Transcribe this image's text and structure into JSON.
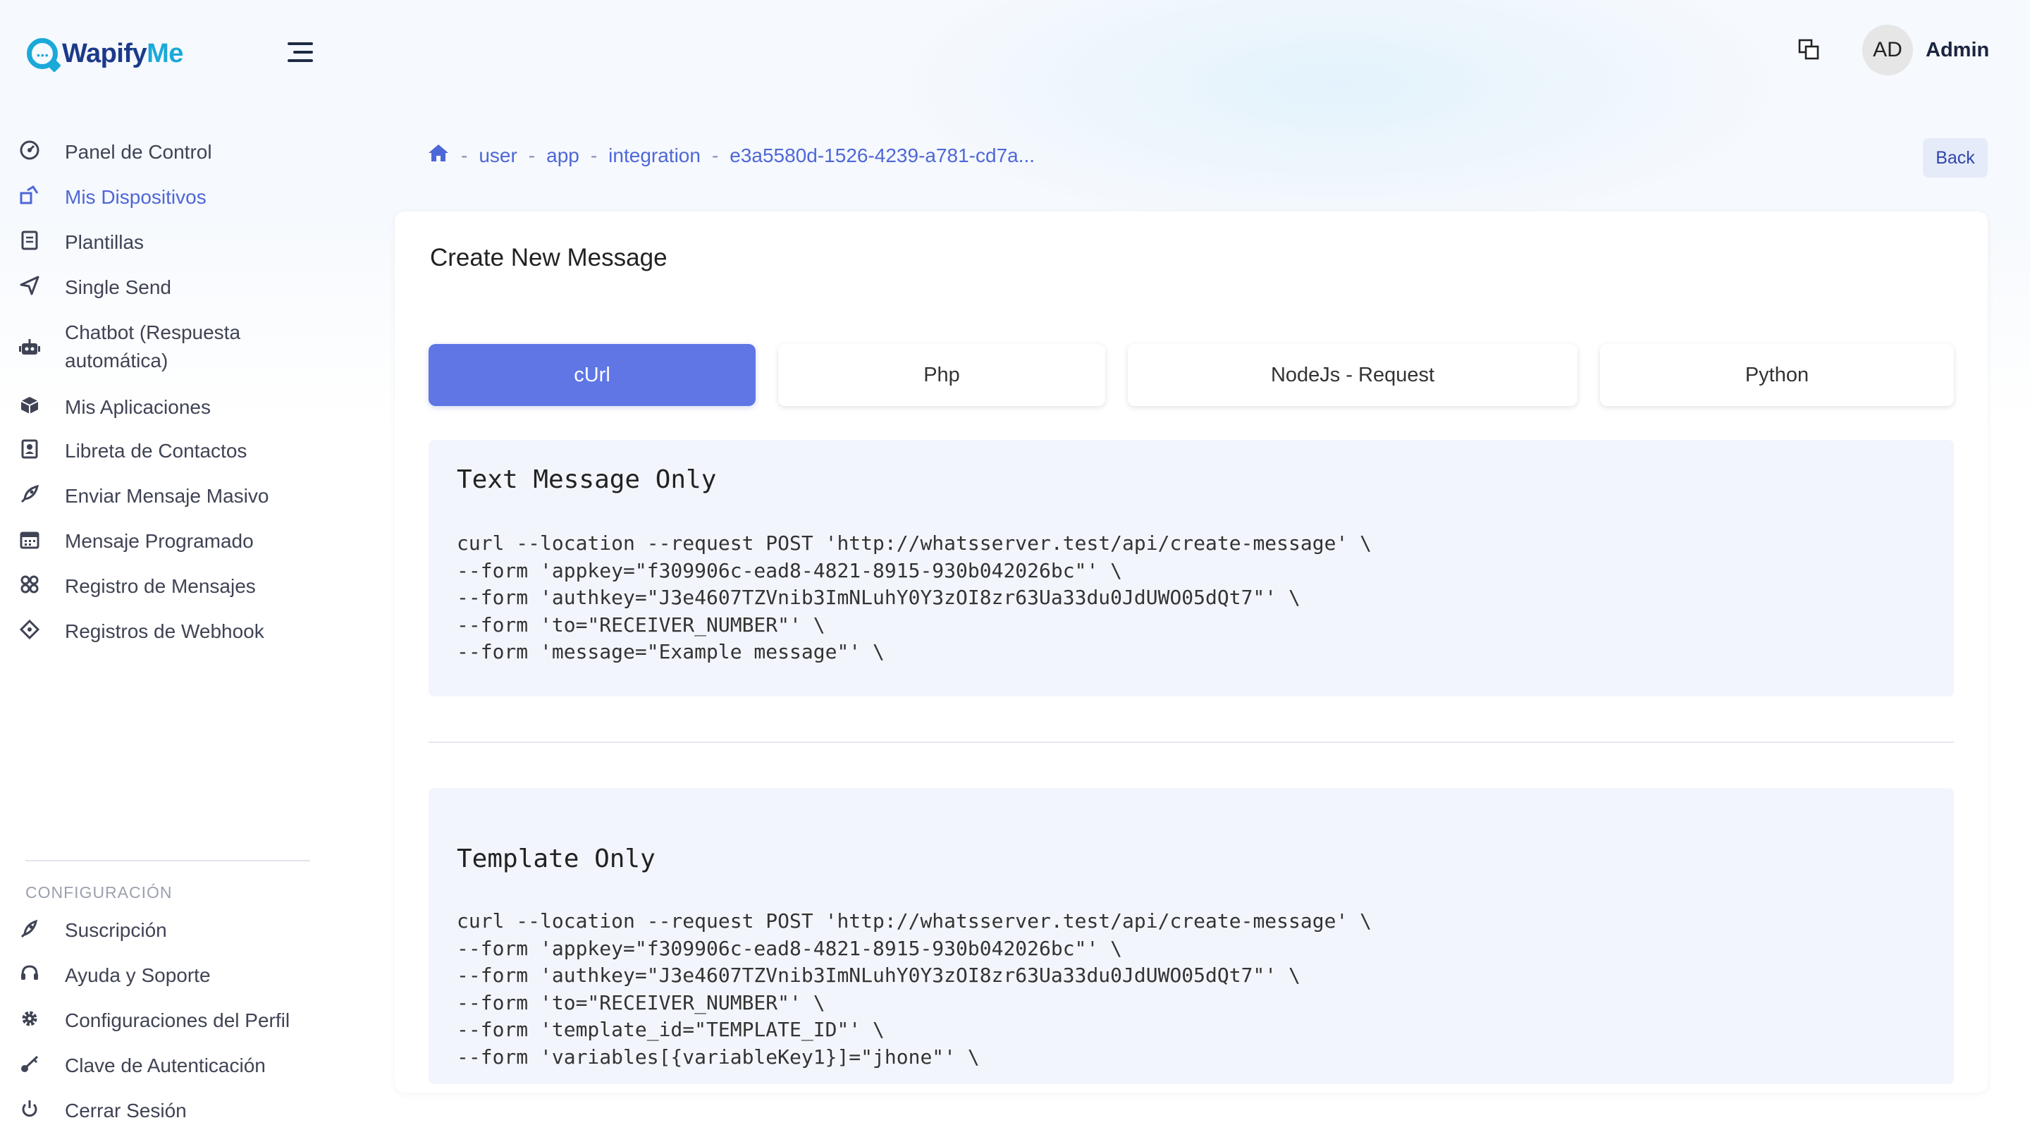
{
  "brand": {
    "name_part1": "Wapify",
    "name_part2": "Me"
  },
  "header": {
    "avatar_initials": "AD",
    "user_name": "Admin"
  },
  "sidebar": {
    "items": [
      {
        "label": "Panel de Control",
        "icon": "dashboard-icon"
      },
      {
        "label": "Mis Dispositivos",
        "icon": "devices-icon",
        "active": true
      },
      {
        "label": "Plantillas",
        "icon": "templates-icon"
      },
      {
        "label": "Single Send",
        "icon": "send-icon"
      },
      {
        "label": "Chatbot (Respuesta automática)",
        "icon": "robot-icon"
      },
      {
        "label": "Mis Aplicaciones",
        "icon": "box-icon"
      },
      {
        "label": "Libreta de Contactos",
        "icon": "contacts-icon"
      },
      {
        "label": "Enviar Mensaje Masivo",
        "icon": "rocket-icon"
      },
      {
        "label": "Mensaje Programado",
        "icon": "calendar-icon"
      },
      {
        "label": "Registro de Mensajes",
        "icon": "logs-icon"
      },
      {
        "label": "Registros de Webhook",
        "icon": "webhook-icon"
      }
    ],
    "settings_title": "CONFIGURACIÓN",
    "settings_items": [
      {
        "label": "Suscripción",
        "icon": "subscription-icon"
      },
      {
        "label": "Ayuda y Soporte",
        "icon": "headset-icon"
      },
      {
        "label": "Configuraciones del Perfil",
        "icon": "gear-icon"
      },
      {
        "label": "Clave de Autenticación",
        "icon": "key-icon"
      },
      {
        "label": "Cerrar Sesión",
        "icon": "power-icon"
      }
    ]
  },
  "breadcrumb": {
    "items": [
      "user",
      "app",
      "integration",
      "e3a5580d-1526-4239-a781-cd7a..."
    ],
    "separator": "-"
  },
  "back_label": "Back",
  "card": {
    "title": "Create New Message",
    "tabs": [
      "cUrl",
      "Php",
      "NodeJs - Request",
      "Python"
    ],
    "active_tab": "cUrl",
    "sections": [
      {
        "heading": "Text Message Only",
        "lines": [
          "curl --location --request POST 'http://whatsserver.test/api/create-message' \\",
          "--form 'appkey=\"f309906c-ead8-4821-8915-930b042026bc\"' \\",
          "--form 'authkey=\"J3e4607TZVnib3ImNLuhY0Y3zOI8zr63Ua33du0JdUWO05dQt7\"' \\",
          "--form 'to=\"RECEIVER_NUMBER\"' \\",
          "--form 'message=\"Example message\"' \\"
        ]
      },
      {
        "heading": "Template Only",
        "lines": [
          "curl --location --request POST 'http://whatsserver.test/api/create-message' \\",
          "--form 'appkey=\"f309906c-ead8-4821-8915-930b042026bc\"' \\",
          "--form 'authkey=\"J3e4607TZVnib3ImNLuhY0Y3zOI8zr63Ua33du0JdUWO05dQt7\"' \\",
          "--form 'to=\"RECEIVER_NUMBER\"' \\",
          "--form 'template_id=\"TEMPLATE_ID\"' \\",
          "--form 'variables[{variableKey1}]=\"jhone\"' \\"
        ]
      }
    ]
  },
  "colors": {
    "accent": "#5f76e4",
    "link": "#4e67d8",
    "brand_dark": "#1b3a8a",
    "brand_light": "#1aa9d9"
  }
}
